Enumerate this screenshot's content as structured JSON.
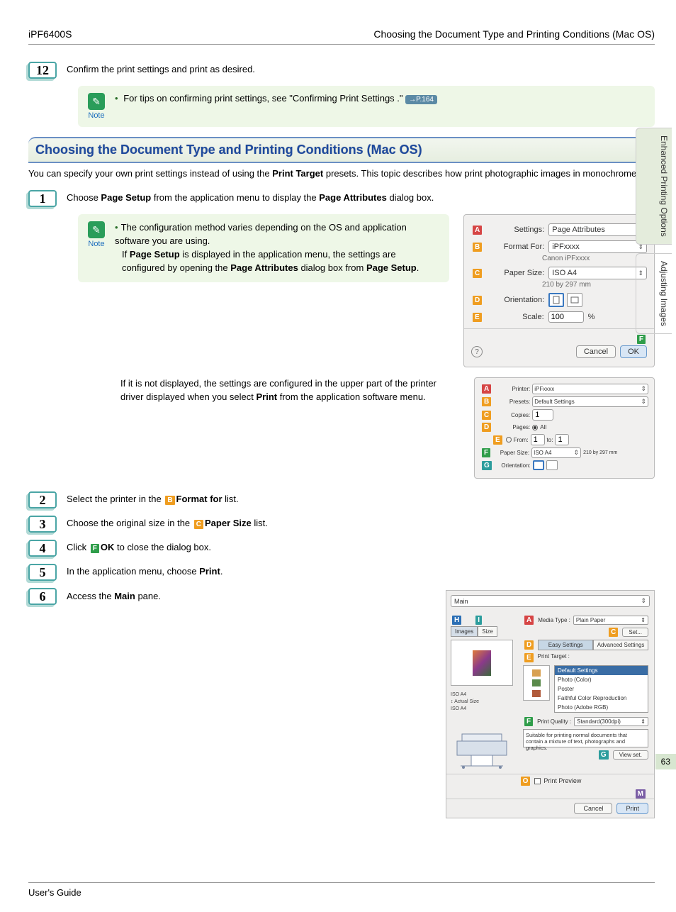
{
  "header": {
    "model": "iPF6400S",
    "breadcrumb": "Choosing the Document Type and Printing Conditions (Mac OS)"
  },
  "sideTabs": {
    "t1": "Enhanced Printing Options",
    "t2": "Adjusting Images"
  },
  "step12": {
    "num": "12",
    "text": "Confirm the print settings and print as desired.",
    "noteLabel": "Note",
    "tip_a": "For tips on confirming print settings, see \"Confirming Print Settings .\" ",
    "pref": "→P.164"
  },
  "section": {
    "title": "Choosing the Document Type and Printing Conditions (Mac OS)"
  },
  "intro": {
    "a": "You can specify your own print settings instead of using the ",
    "b": "Print Target",
    "c": " presets. This topic describes how print photographic images in monochrome."
  },
  "step1": {
    "num": "1",
    "a": "Choose ",
    "b": "Page Setup",
    "c": " from the application menu to display the ",
    "d": "Page Attributes",
    "e": " dialog box.",
    "noteLabel": "Note",
    "note1a": "The configuration method varies depending on the OS and application software you are using.",
    "note1b_a": "If ",
    "note1b_b": "Page Setup",
    "note1b_c": " is displayed in the application menu, the settings are configured by opening the ",
    "note1b_d": "Page Attributes",
    "note1b_e": " dialog box from ",
    "note1b_f": "Page Setup",
    "note1b_g": ".",
    "alt_a": "If it is not displayed, the settings are configured in the upper part of the printer driver displayed when you select ",
    "alt_b": "Print",
    "alt_c": " from the application software menu."
  },
  "dlg1": {
    "A": "A",
    "B": "B",
    "C": "C",
    "D": "D",
    "E": "E",
    "F": "F",
    "settings_l": "Settings:",
    "settings_v": "Page Attributes",
    "format_l": "Format For:",
    "format_v": "iPFxxxx",
    "format_sub": "Canon iPFxxxx",
    "paper_l": "Paper Size:",
    "paper_v": "ISO A4",
    "paper_sub": "210 by 297 mm",
    "orient_l": "Orientation:",
    "scale_l": "Scale:",
    "scale_v": "100",
    "scale_pct": "%",
    "cancel": "Cancel",
    "ok": "OK"
  },
  "dlg2": {
    "A": "A",
    "B": "B",
    "C": "C",
    "D": "D",
    "E": "E",
    "F": "F",
    "G": "G",
    "printer_l": "Printer:",
    "printer_v": "iPFxxxx",
    "presets_l": "Presets:",
    "presets_v": "Default Settings",
    "copies_l": "Copies:",
    "copies_v": "1",
    "pages_l": "Pages:",
    "pages_all": "All",
    "pages_from": "From:",
    "pages_from_v": "1",
    "pages_to": "to:",
    "pages_to_v": "1",
    "paper_l": "Paper Size:",
    "paper_v": "ISO A4",
    "paper_dim": "210 by 297 mm",
    "orient_l": "Orientation:"
  },
  "step2": {
    "num": "2",
    "a": "Select the printer in the ",
    "b": "Format for",
    "c": " list.",
    "L": "B"
  },
  "step3": {
    "num": "3",
    "a": "Choose the original size in the ",
    "b": "Paper Size",
    "c": " list.",
    "L": "C"
  },
  "step4": {
    "num": "4",
    "a": "Click ",
    "b": "OK",
    "c": " to close the dialog box.",
    "L": "F"
  },
  "step5": {
    "num": "5",
    "a": "In the application menu, choose ",
    "b": "Print",
    "c": "."
  },
  "step6": {
    "num": "6",
    "a": "Access the ",
    "b": "Main",
    "c": " pane."
  },
  "dlg3": {
    "main_sel": "Main",
    "H": "H",
    "I": "I",
    "A": "A",
    "C": "C",
    "D": "D",
    "E": "E",
    "F": "F",
    "G": "G",
    "O": "O",
    "M": "M",
    "tab_images": "Images",
    "tab_size": "Size",
    "tiny1": "ISO A4",
    "tiny2": "Actual Size",
    "tiny3": "ISO A4",
    "media_l": "Media Type :",
    "media_v": "Plain Paper",
    "set": "Set...",
    "easy": "Easy Settings",
    "adv": "Advanced Settings",
    "target_l": "Print Target :",
    "t1": "Default Settings",
    "t2": "Photo (Color)",
    "t3": "Poster",
    "t4": "Faithful Color Reproduction",
    "t5": "Photo (Adobe RGB)",
    "quality_l": "Print Quality :",
    "quality_v": "Standard(300dpi)",
    "desc": "Suitable for printing normal documents that contain a mixture of text, photographs and graphics.",
    "view": "View set.",
    "pp": "Print Preview",
    "cancel": "Cancel",
    "print": "Print"
  },
  "pageNum": "63",
  "footer": "User's Guide"
}
